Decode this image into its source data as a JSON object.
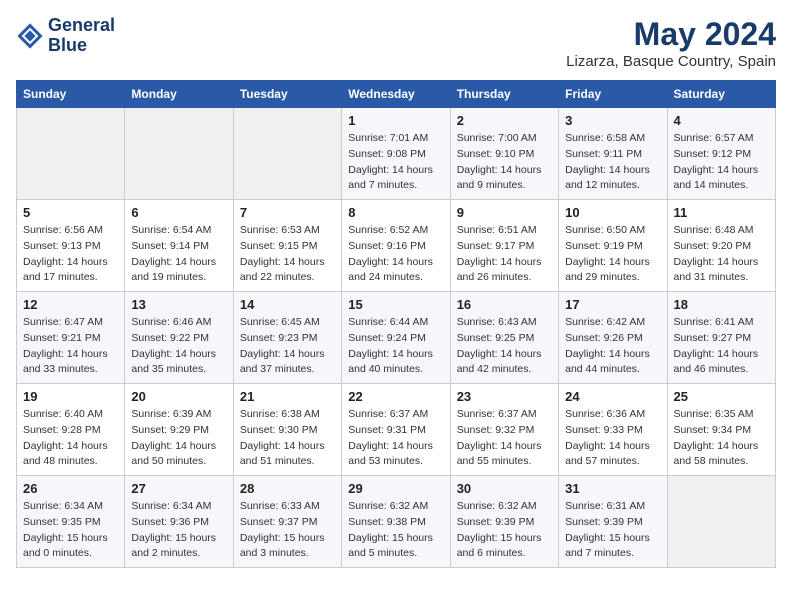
{
  "header": {
    "logo_line1": "General",
    "logo_line2": "Blue",
    "title": "May 2024",
    "subtitle": "Lizarza, Basque Country, Spain"
  },
  "calendar": {
    "days_of_week": [
      "Sunday",
      "Monday",
      "Tuesday",
      "Wednesday",
      "Thursday",
      "Friday",
      "Saturday"
    ],
    "weeks": [
      [
        {
          "day": "",
          "empty": true
        },
        {
          "day": "",
          "empty": true
        },
        {
          "day": "",
          "empty": true
        },
        {
          "day": "1",
          "sunrise": "Sunrise: 7:01 AM",
          "sunset": "Sunset: 9:08 PM",
          "daylight": "Daylight: 14 hours and 7 minutes."
        },
        {
          "day": "2",
          "sunrise": "Sunrise: 7:00 AM",
          "sunset": "Sunset: 9:10 PM",
          "daylight": "Daylight: 14 hours and 9 minutes."
        },
        {
          "day": "3",
          "sunrise": "Sunrise: 6:58 AM",
          "sunset": "Sunset: 9:11 PM",
          "daylight": "Daylight: 14 hours and 12 minutes."
        },
        {
          "day": "4",
          "sunrise": "Sunrise: 6:57 AM",
          "sunset": "Sunset: 9:12 PM",
          "daylight": "Daylight: 14 hours and 14 minutes."
        }
      ],
      [
        {
          "day": "5",
          "sunrise": "Sunrise: 6:56 AM",
          "sunset": "Sunset: 9:13 PM",
          "daylight": "Daylight: 14 hours and 17 minutes."
        },
        {
          "day": "6",
          "sunrise": "Sunrise: 6:54 AM",
          "sunset": "Sunset: 9:14 PM",
          "daylight": "Daylight: 14 hours and 19 minutes."
        },
        {
          "day": "7",
          "sunrise": "Sunrise: 6:53 AM",
          "sunset": "Sunset: 9:15 PM",
          "daylight": "Daylight: 14 hours and 22 minutes."
        },
        {
          "day": "8",
          "sunrise": "Sunrise: 6:52 AM",
          "sunset": "Sunset: 9:16 PM",
          "daylight": "Daylight: 14 hours and 24 minutes."
        },
        {
          "day": "9",
          "sunrise": "Sunrise: 6:51 AM",
          "sunset": "Sunset: 9:17 PM",
          "daylight": "Daylight: 14 hours and 26 minutes."
        },
        {
          "day": "10",
          "sunrise": "Sunrise: 6:50 AM",
          "sunset": "Sunset: 9:19 PM",
          "daylight": "Daylight: 14 hours and 29 minutes."
        },
        {
          "day": "11",
          "sunrise": "Sunrise: 6:48 AM",
          "sunset": "Sunset: 9:20 PM",
          "daylight": "Daylight: 14 hours and 31 minutes."
        }
      ],
      [
        {
          "day": "12",
          "sunrise": "Sunrise: 6:47 AM",
          "sunset": "Sunset: 9:21 PM",
          "daylight": "Daylight: 14 hours and 33 minutes."
        },
        {
          "day": "13",
          "sunrise": "Sunrise: 6:46 AM",
          "sunset": "Sunset: 9:22 PM",
          "daylight": "Daylight: 14 hours and 35 minutes."
        },
        {
          "day": "14",
          "sunrise": "Sunrise: 6:45 AM",
          "sunset": "Sunset: 9:23 PM",
          "daylight": "Daylight: 14 hours and 37 minutes."
        },
        {
          "day": "15",
          "sunrise": "Sunrise: 6:44 AM",
          "sunset": "Sunset: 9:24 PM",
          "daylight": "Daylight: 14 hours and 40 minutes."
        },
        {
          "day": "16",
          "sunrise": "Sunrise: 6:43 AM",
          "sunset": "Sunset: 9:25 PM",
          "daylight": "Daylight: 14 hours and 42 minutes."
        },
        {
          "day": "17",
          "sunrise": "Sunrise: 6:42 AM",
          "sunset": "Sunset: 9:26 PM",
          "daylight": "Daylight: 14 hours and 44 minutes."
        },
        {
          "day": "18",
          "sunrise": "Sunrise: 6:41 AM",
          "sunset": "Sunset: 9:27 PM",
          "daylight": "Daylight: 14 hours and 46 minutes."
        }
      ],
      [
        {
          "day": "19",
          "sunrise": "Sunrise: 6:40 AM",
          "sunset": "Sunset: 9:28 PM",
          "daylight": "Daylight: 14 hours and 48 minutes."
        },
        {
          "day": "20",
          "sunrise": "Sunrise: 6:39 AM",
          "sunset": "Sunset: 9:29 PM",
          "daylight": "Daylight: 14 hours and 50 minutes."
        },
        {
          "day": "21",
          "sunrise": "Sunrise: 6:38 AM",
          "sunset": "Sunset: 9:30 PM",
          "daylight": "Daylight: 14 hours and 51 minutes."
        },
        {
          "day": "22",
          "sunrise": "Sunrise: 6:37 AM",
          "sunset": "Sunset: 9:31 PM",
          "daylight": "Daylight: 14 hours and 53 minutes."
        },
        {
          "day": "23",
          "sunrise": "Sunrise: 6:37 AM",
          "sunset": "Sunset: 9:32 PM",
          "daylight": "Daylight: 14 hours and 55 minutes."
        },
        {
          "day": "24",
          "sunrise": "Sunrise: 6:36 AM",
          "sunset": "Sunset: 9:33 PM",
          "daylight": "Daylight: 14 hours and 57 minutes."
        },
        {
          "day": "25",
          "sunrise": "Sunrise: 6:35 AM",
          "sunset": "Sunset: 9:34 PM",
          "daylight": "Daylight: 14 hours and 58 minutes."
        }
      ],
      [
        {
          "day": "26",
          "sunrise": "Sunrise: 6:34 AM",
          "sunset": "Sunset: 9:35 PM",
          "daylight": "Daylight: 15 hours and 0 minutes."
        },
        {
          "day": "27",
          "sunrise": "Sunrise: 6:34 AM",
          "sunset": "Sunset: 9:36 PM",
          "daylight": "Daylight: 15 hours and 2 minutes."
        },
        {
          "day": "28",
          "sunrise": "Sunrise: 6:33 AM",
          "sunset": "Sunset: 9:37 PM",
          "daylight": "Daylight: 15 hours and 3 minutes."
        },
        {
          "day": "29",
          "sunrise": "Sunrise: 6:32 AM",
          "sunset": "Sunset: 9:38 PM",
          "daylight": "Daylight: 15 hours and 5 minutes."
        },
        {
          "day": "30",
          "sunrise": "Sunrise: 6:32 AM",
          "sunset": "Sunset: 9:39 PM",
          "daylight": "Daylight: 15 hours and 6 minutes."
        },
        {
          "day": "31",
          "sunrise": "Sunrise: 6:31 AM",
          "sunset": "Sunset: 9:39 PM",
          "daylight": "Daylight: 15 hours and 7 minutes."
        },
        {
          "day": "",
          "empty": true
        }
      ]
    ]
  }
}
